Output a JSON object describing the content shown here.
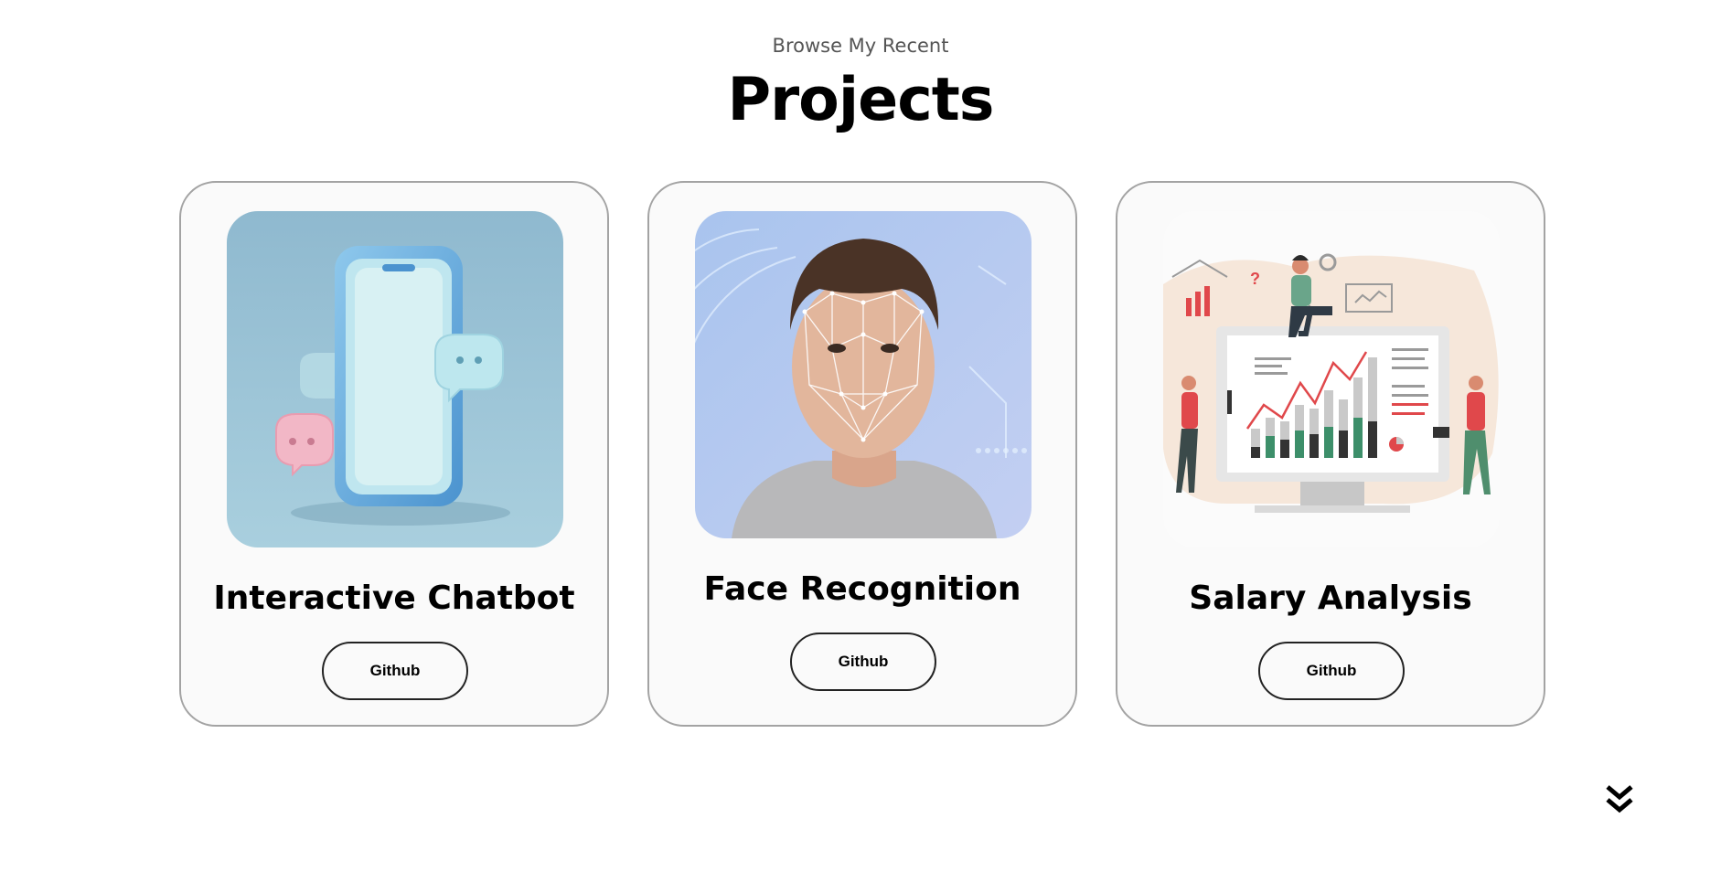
{
  "header": {
    "eyebrow": "Browse My Recent",
    "title": "Projects"
  },
  "projects": [
    {
      "title": "Interactive Chatbot",
      "button_label": "Github",
      "image_icon": "chatbot-phone-illustration"
    },
    {
      "title": "Face Recognition",
      "button_label": "Github",
      "image_icon": "face-mesh-photo"
    },
    {
      "title": "Salary Analysis",
      "button_label": "Github",
      "image_icon": "data-analysis-illustration"
    }
  ],
  "nav": {
    "scroll_icon": "double-chevron-down-icon"
  },
  "colors": {
    "card_bg": "#fafafa",
    "card_border": "#a3a3a3",
    "accent_red": "#e0484b",
    "accent_green": "#3d8f6a"
  }
}
